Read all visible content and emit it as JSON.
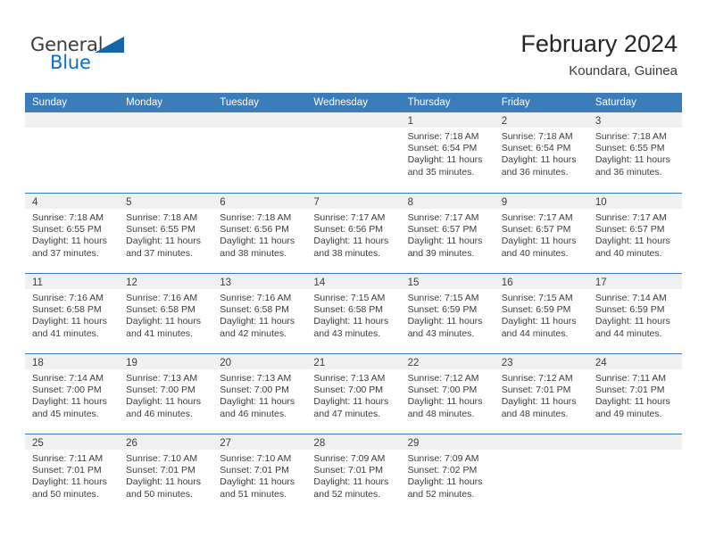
{
  "brand": {
    "name_part1": "General",
    "name_part2": "Blue",
    "accent_color": "#0f6fc5",
    "triangle_color": "#1565a8"
  },
  "header": {
    "title": "February 2024",
    "location": "Koundara, Guinea"
  },
  "calendar": {
    "header_bg": "#3b7cb9",
    "daynum_bg": "#f0f0f0",
    "weekdays": [
      "Sunday",
      "Monday",
      "Tuesday",
      "Wednesday",
      "Thursday",
      "Friday",
      "Saturday"
    ],
    "weeks": [
      [
        {
          "day": "",
          "lines": []
        },
        {
          "day": "",
          "lines": []
        },
        {
          "day": "",
          "lines": []
        },
        {
          "day": "",
          "lines": []
        },
        {
          "day": "1",
          "lines": [
            "Sunrise: 7:18 AM",
            "Sunset: 6:54 PM",
            "Daylight: 11 hours",
            "and 35 minutes."
          ]
        },
        {
          "day": "2",
          "lines": [
            "Sunrise: 7:18 AM",
            "Sunset: 6:54 PM",
            "Daylight: 11 hours",
            "and 36 minutes."
          ]
        },
        {
          "day": "3",
          "lines": [
            "Sunrise: 7:18 AM",
            "Sunset: 6:55 PM",
            "Daylight: 11 hours",
            "and 36 minutes."
          ]
        }
      ],
      [
        {
          "day": "4",
          "lines": [
            "Sunrise: 7:18 AM",
            "Sunset: 6:55 PM",
            "Daylight: 11 hours",
            "and 37 minutes."
          ]
        },
        {
          "day": "5",
          "lines": [
            "Sunrise: 7:18 AM",
            "Sunset: 6:55 PM",
            "Daylight: 11 hours",
            "and 37 minutes."
          ]
        },
        {
          "day": "6",
          "lines": [
            "Sunrise: 7:18 AM",
            "Sunset: 6:56 PM",
            "Daylight: 11 hours",
            "and 38 minutes."
          ]
        },
        {
          "day": "7",
          "lines": [
            "Sunrise: 7:17 AM",
            "Sunset: 6:56 PM",
            "Daylight: 11 hours",
            "and 38 minutes."
          ]
        },
        {
          "day": "8",
          "lines": [
            "Sunrise: 7:17 AM",
            "Sunset: 6:57 PM",
            "Daylight: 11 hours",
            "and 39 minutes."
          ]
        },
        {
          "day": "9",
          "lines": [
            "Sunrise: 7:17 AM",
            "Sunset: 6:57 PM",
            "Daylight: 11 hours",
            "and 40 minutes."
          ]
        },
        {
          "day": "10",
          "lines": [
            "Sunrise: 7:17 AM",
            "Sunset: 6:57 PM",
            "Daylight: 11 hours",
            "and 40 minutes."
          ]
        }
      ],
      [
        {
          "day": "11",
          "lines": [
            "Sunrise: 7:16 AM",
            "Sunset: 6:58 PM",
            "Daylight: 11 hours",
            "and 41 minutes."
          ]
        },
        {
          "day": "12",
          "lines": [
            "Sunrise: 7:16 AM",
            "Sunset: 6:58 PM",
            "Daylight: 11 hours",
            "and 41 minutes."
          ]
        },
        {
          "day": "13",
          "lines": [
            "Sunrise: 7:16 AM",
            "Sunset: 6:58 PM",
            "Daylight: 11 hours",
            "and 42 minutes."
          ]
        },
        {
          "day": "14",
          "lines": [
            "Sunrise: 7:15 AM",
            "Sunset: 6:58 PM",
            "Daylight: 11 hours",
            "and 43 minutes."
          ]
        },
        {
          "day": "15",
          "lines": [
            "Sunrise: 7:15 AM",
            "Sunset: 6:59 PM",
            "Daylight: 11 hours",
            "and 43 minutes."
          ]
        },
        {
          "day": "16",
          "lines": [
            "Sunrise: 7:15 AM",
            "Sunset: 6:59 PM",
            "Daylight: 11 hours",
            "and 44 minutes."
          ]
        },
        {
          "day": "17",
          "lines": [
            "Sunrise: 7:14 AM",
            "Sunset: 6:59 PM",
            "Daylight: 11 hours",
            "and 44 minutes."
          ]
        }
      ],
      [
        {
          "day": "18",
          "lines": [
            "Sunrise: 7:14 AM",
            "Sunset: 7:00 PM",
            "Daylight: 11 hours",
            "and 45 minutes."
          ]
        },
        {
          "day": "19",
          "lines": [
            "Sunrise: 7:13 AM",
            "Sunset: 7:00 PM",
            "Daylight: 11 hours",
            "and 46 minutes."
          ]
        },
        {
          "day": "20",
          "lines": [
            "Sunrise: 7:13 AM",
            "Sunset: 7:00 PM",
            "Daylight: 11 hours",
            "and 46 minutes."
          ]
        },
        {
          "day": "21",
          "lines": [
            "Sunrise: 7:13 AM",
            "Sunset: 7:00 PM",
            "Daylight: 11 hours",
            "and 47 minutes."
          ]
        },
        {
          "day": "22",
          "lines": [
            "Sunrise: 7:12 AM",
            "Sunset: 7:00 PM",
            "Daylight: 11 hours",
            "and 48 minutes."
          ]
        },
        {
          "day": "23",
          "lines": [
            "Sunrise: 7:12 AM",
            "Sunset: 7:01 PM",
            "Daylight: 11 hours",
            "and 48 minutes."
          ]
        },
        {
          "day": "24",
          "lines": [
            "Sunrise: 7:11 AM",
            "Sunset: 7:01 PM",
            "Daylight: 11 hours",
            "and 49 minutes."
          ]
        }
      ],
      [
        {
          "day": "25",
          "lines": [
            "Sunrise: 7:11 AM",
            "Sunset: 7:01 PM",
            "Daylight: 11 hours",
            "and 50 minutes."
          ]
        },
        {
          "day": "26",
          "lines": [
            "Sunrise: 7:10 AM",
            "Sunset: 7:01 PM",
            "Daylight: 11 hours",
            "and 50 minutes."
          ]
        },
        {
          "day": "27",
          "lines": [
            "Sunrise: 7:10 AM",
            "Sunset: 7:01 PM",
            "Daylight: 11 hours",
            "and 51 minutes."
          ]
        },
        {
          "day": "28",
          "lines": [
            "Sunrise: 7:09 AM",
            "Sunset: 7:01 PM",
            "Daylight: 11 hours",
            "and 52 minutes."
          ]
        },
        {
          "day": "29",
          "lines": [
            "Sunrise: 7:09 AM",
            "Sunset: 7:02 PM",
            "Daylight: 11 hours",
            "and 52 minutes."
          ]
        },
        {
          "day": "",
          "lines": []
        },
        {
          "day": "",
          "lines": []
        }
      ]
    ]
  }
}
